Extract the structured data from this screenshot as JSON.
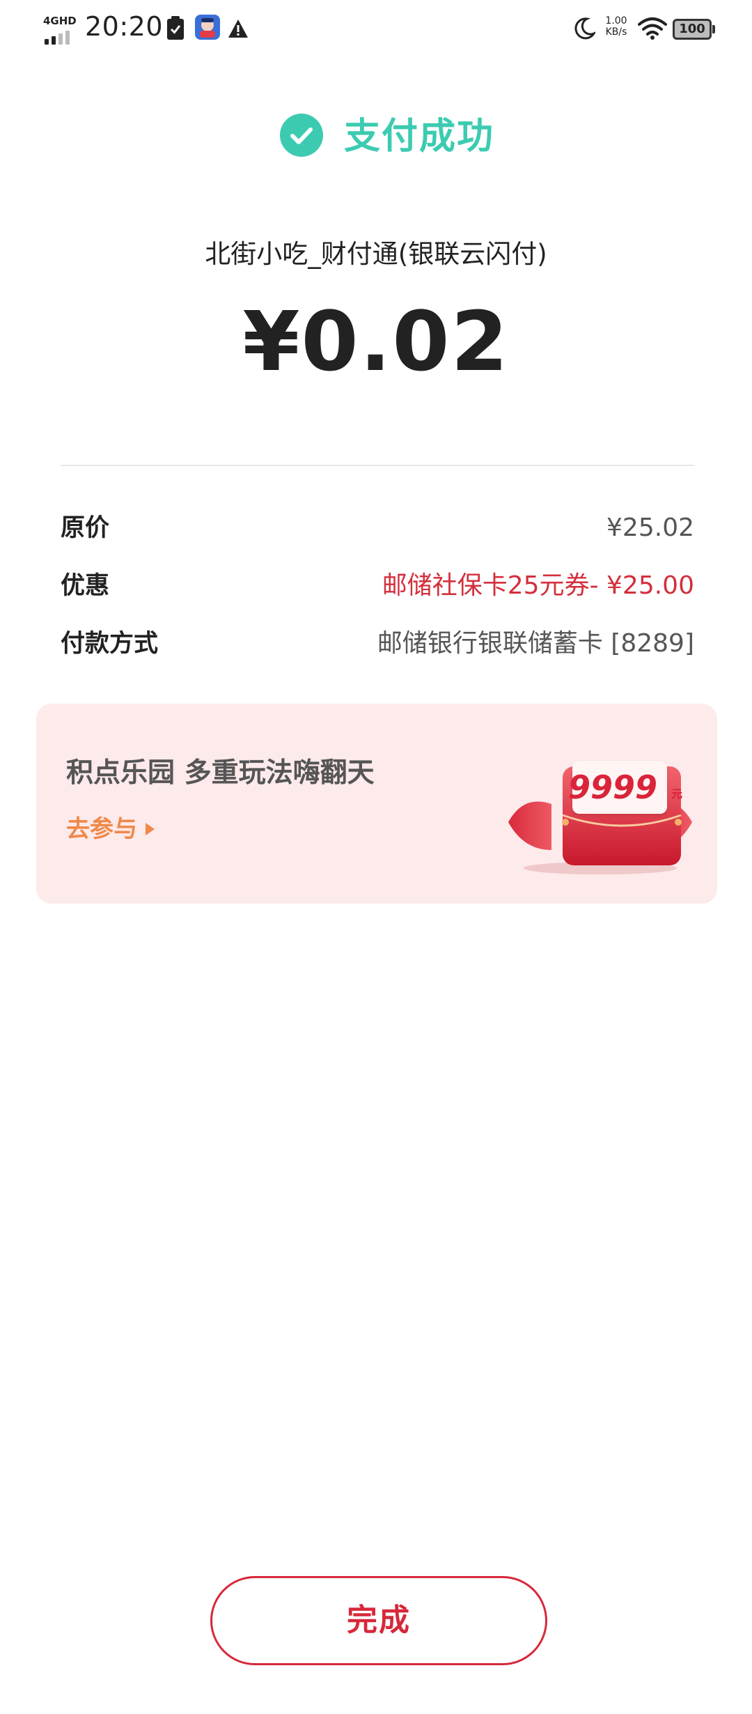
{
  "status_bar": {
    "network_type": "4GHD",
    "time": "20:20",
    "net_speed_value": "1.00",
    "net_speed_unit": "KB/s",
    "battery": "100",
    "icons": [
      "signal-icon",
      "clipboard-check-icon",
      "app-notification-icon",
      "warning-icon",
      "moon-icon",
      "wifi-icon",
      "battery-icon"
    ]
  },
  "header": {
    "status_title": "支付成功",
    "status_icon": "check-circle-icon",
    "accent_color": "#3ccbb1"
  },
  "payment": {
    "merchant": "北街小吃_财付通(银联云闪付)",
    "amount": "¥0.02"
  },
  "details": [
    {
      "label": "原价",
      "value": "¥25.02",
      "highlight": false
    },
    {
      "label": "优惠",
      "value": "邮储社保卡25元券- ¥25.00",
      "highlight": true
    },
    {
      "label": "付款方式",
      "value": "邮储银行银联储蓄卡 [8289]",
      "highlight": false
    }
  ],
  "promo": {
    "title": "积点乐园 多重玩法嗨翻天",
    "link": "去参与",
    "gift_amount": "9999",
    "gift_unit": "元",
    "background_color": "#fdeaeb",
    "link_color": "#f0894a"
  },
  "footer": {
    "done_label": "完成",
    "button_color": "#d7283a"
  }
}
